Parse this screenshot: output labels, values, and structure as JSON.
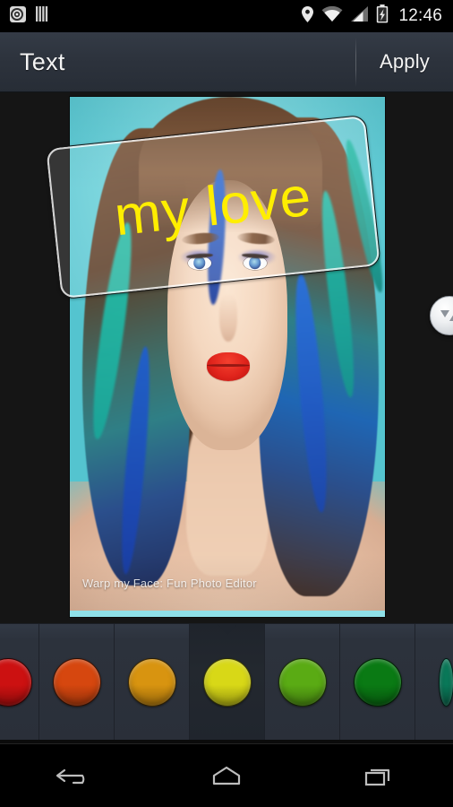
{
  "statusbar": {
    "time": "12:46",
    "left_icons": [
      {
        "name": "camera-app-icon"
      },
      {
        "name": "barcode-icon"
      }
    ],
    "right_icons": [
      {
        "name": "location-pin-icon"
      },
      {
        "name": "wifi-icon"
      },
      {
        "name": "cellular-signal-icon"
      },
      {
        "name": "battery-charging-icon"
      }
    ]
  },
  "actionbar": {
    "title": "Text",
    "apply_label": "Apply"
  },
  "editor": {
    "overlay_text": "my love",
    "overlay_text_color": "#ffee00",
    "overlay_rotation_deg": -6,
    "watermark": "Warp my Face: Fun Photo Editor",
    "handle_name": "resize-rotate-handle"
  },
  "palette": {
    "selected_index": 3,
    "swatches": [
      {
        "name": "color-red",
        "hex": "#cc1111",
        "partial": true
      },
      {
        "name": "color-orange-red",
        "hex": "#d6470f"
      },
      {
        "name": "color-amber",
        "hex": "#d89410"
      },
      {
        "name": "color-yellow",
        "hex": "#d8d817"
      },
      {
        "name": "color-light-green",
        "hex": "#5aab14"
      },
      {
        "name": "color-green",
        "hex": "#0a7a14"
      },
      {
        "name": "color-teal",
        "hex": "#0a7a5a",
        "partial": true
      }
    ]
  },
  "navbar": {
    "buttons": [
      {
        "name": "nav-back-button"
      },
      {
        "name": "nav-home-button"
      },
      {
        "name": "nav-recents-button"
      }
    ]
  }
}
